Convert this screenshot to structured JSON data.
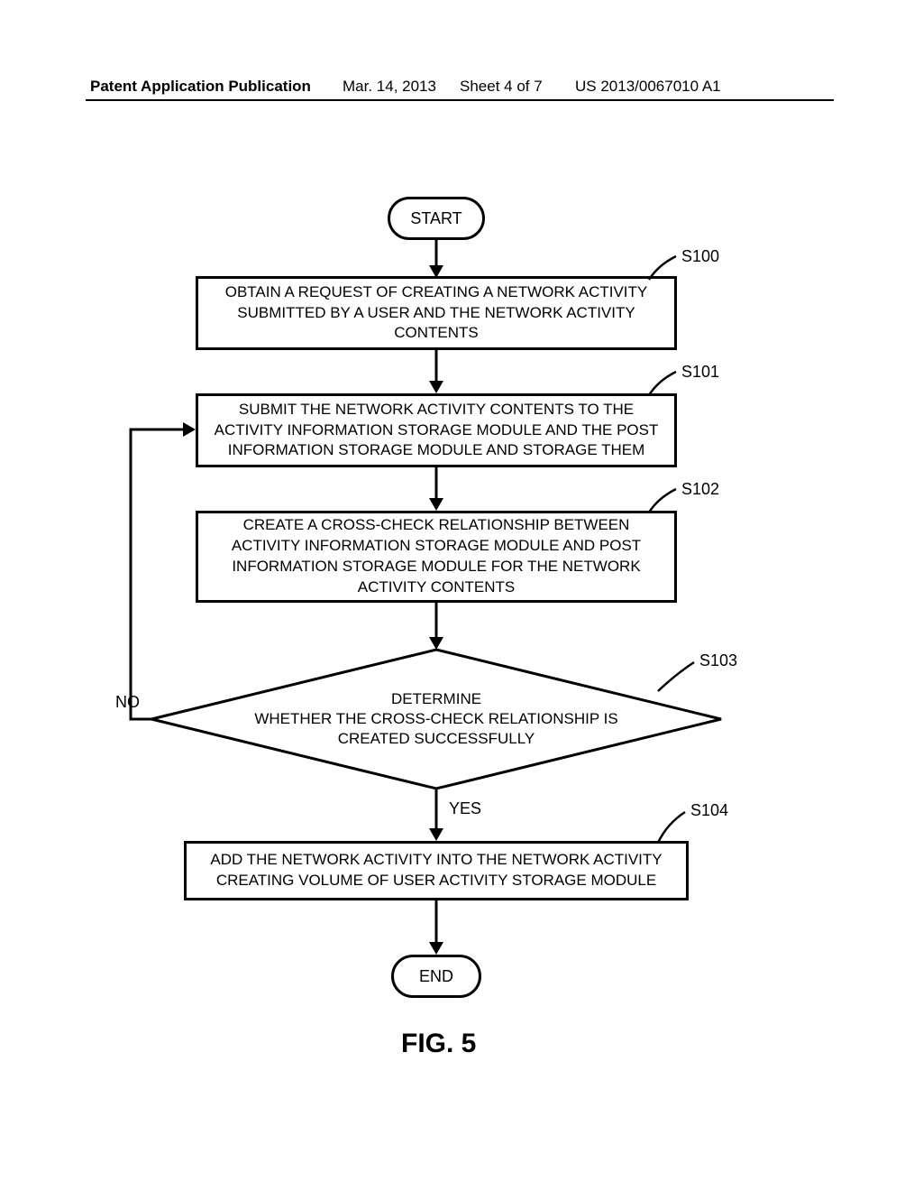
{
  "header": {
    "publication_label": "Patent Application Publication",
    "date": "Mar. 14, 2013",
    "sheet": "Sheet 4 of 7",
    "pubno": "US 2013/0067010 A1"
  },
  "flowchart": {
    "start": "START",
    "end": "END",
    "step100": "OBTAIN A REQUEST OF CREATING A NETWORK ACTIVITY SUBMITTED BY A USER AND THE NETWORK ACTIVITY CONTENTS",
    "step101": "SUBMIT THE NETWORK ACTIVITY CONTENTS TO THE ACTIVITY INFORMATION STORAGE MODULE AND THE POST INFORMATION STORAGE MODULE  AND STORAGE THEM",
    "step102": "CREATE A CROSS-CHECK RELATIONSHIP BETWEEN ACTIVITY INFORMATION STORAGE MODULE  AND POST INFORMATION STORAGE MODULE  FOR THE NETWORK ACTIVITY CONTENTS",
    "decision_line1": "DETERMINE",
    "decision_line2": "WHETHER THE CROSS-CHECK RELATIONSHIP IS",
    "decision_line3": "CREATED SUCCESSFULLY",
    "step104": "ADD THE NETWORK ACTIVITY INTO THE NETWORK ACTIVITY CREATING VOLUME OF USER ACTIVITY STORAGE MODULE",
    "no": "NO",
    "yes": "YES",
    "s100": "S100",
    "s101": "S101",
    "s102": "S102",
    "s103": "S103",
    "s104": "S104"
  },
  "figure_label": "FIG. 5"
}
